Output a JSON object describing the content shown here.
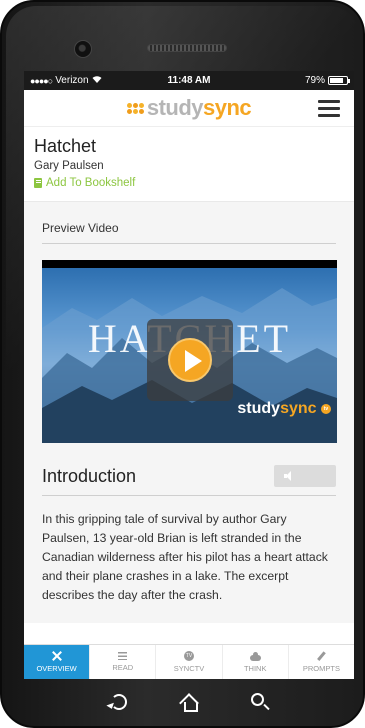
{
  "status_bar": {
    "carrier": "Verizon",
    "signal": "●●●●○",
    "time": "11:48 AM",
    "battery": "79%",
    "battery_level": 0.79
  },
  "app_bar": {
    "logo_study": "study",
    "logo_sync": "sync"
  },
  "book": {
    "title": "Hatchet",
    "author": "Gary Paulsen",
    "add_to_bookshelf": "Add To Bookshelf"
  },
  "preview": {
    "label": "Preview Video",
    "video_title": "HATCHET",
    "brand_study": "study",
    "brand_sync": "sync",
    "brand_badge": "tv"
  },
  "introduction": {
    "title": "Introduction",
    "text": "In this gripping tale of survival by author Gary Paulsen, 13 year-old Brian is left stranded in the Canadian wilderness after his pilot has a heart attack and their plane crashes in a lake. The excerpt describes the day after the crash."
  },
  "tabs": [
    {
      "label": "OVERVIEW",
      "icon": "overview-icon",
      "active": true
    },
    {
      "label": "READ",
      "icon": "read-icon",
      "active": false
    },
    {
      "label": "SYNCTV",
      "icon": "synctv-icon",
      "active": false
    },
    {
      "label": "THINK",
      "icon": "cloud-icon",
      "active": false
    },
    {
      "label": "PROMPTS",
      "icon": "pencil-icon",
      "active": false
    }
  ],
  "colors": {
    "accent_orange": "#f5a623",
    "green": "#8dc641",
    "tab_active": "#2196d6"
  }
}
